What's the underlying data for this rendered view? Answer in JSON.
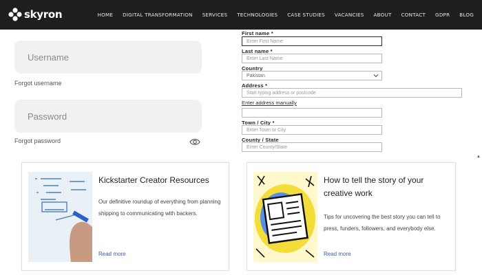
{
  "brand": {
    "name": "skyron"
  },
  "nav": {
    "items": [
      "HOME",
      "DIGITAL TRANSFORMATION",
      "SERVICES",
      "TECHNOLOGIES",
      "CASE STUDIES",
      "VACANCIES",
      "ABOUT",
      "CONTACT",
      "GDPR",
      "BLOG"
    ]
  },
  "login": {
    "username_placeholder": "Username",
    "forgot_username": "Forgot username",
    "password_placeholder": "Password",
    "forgot_password": "Forgot password"
  },
  "form": {
    "first_name_label": "First name *",
    "first_name_placeholder": "Enter First Name",
    "last_name_label": "Last name *",
    "last_name_placeholder": "Enter Last Name",
    "country_label": "Country",
    "country_value": "Pakistan",
    "address_label": "Address *",
    "address_placeholder": "Start typing address or postcode",
    "manual_link": "Enter address manually",
    "manual_value": "",
    "town_label": "Town / City *",
    "town_placeholder": "Enter Town or City",
    "county_label": "County / State",
    "county_placeholder": "Enter County/State"
  },
  "cards": [
    {
      "title": "Kickstarter Creator Resources",
      "description": "Our definitive roundup of everything from planning shipping to communicating with backers.",
      "link": "Read more"
    },
    {
      "title": "How to tell the story of your creative work",
      "description": "Tips for uncovering the best story you can tell to press, funders, followers, and everybody else.",
      "link": "Read more"
    }
  ],
  "colors": {
    "nav_bg": "#1e1e1e",
    "link": "#3b5aa8",
    "field_bg": "#f1f1f1"
  }
}
